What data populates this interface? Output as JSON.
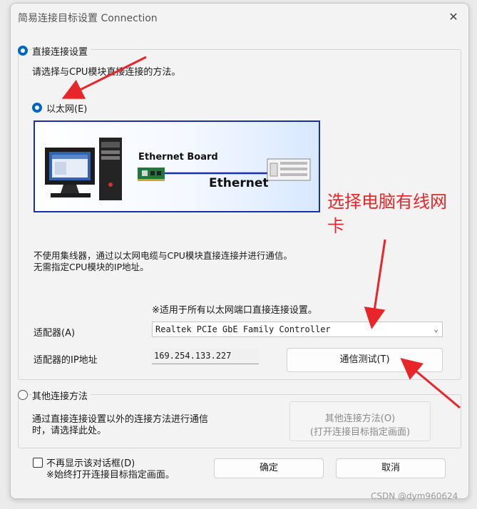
{
  "window": {
    "title": "简易连接目标设置 Connection",
    "close_glyph": "✕"
  },
  "direct_section": {
    "label": "直接连接设置",
    "selected": true,
    "instruction": "请选择与CPU模块直接连接的方法。",
    "ethernet_option": {
      "label": "以太网(E)",
      "selected": true
    },
    "diagram": {
      "board_label": "Ethernet Board",
      "cable_label": "Ethernet"
    },
    "description_line1": "不使用集线器，通过以太网电缆与CPU模块直接连接并进行通信。",
    "description_line2": "无需指定CPU模块的IP地址。",
    "note": "※适用于所有以太网端口直接连接设置。",
    "adapter_label": "适配器(A)",
    "adapter_value": "Realtek PCIe GbE Family Controller",
    "ip_label": "适配器的IP地址",
    "ip_value": "169.254.133.227",
    "test_button": "通信测试(T)"
  },
  "other_section": {
    "label": "其他连接方法",
    "selected": false,
    "description_line1": "通过直接连接设置以外的连接方法进行通信",
    "description_line2": "时，请选择此处。",
    "button_line1": "其他连接方法(O)",
    "button_line2": "(打开连接目标指定画面)"
  },
  "footer": {
    "checkbox_label": "不再显示该对话框(D)",
    "checkbox_note": "※始终打开连接目标指定画面。",
    "checked": false,
    "ok_button": "确定",
    "cancel_button": "取消"
  },
  "annotation": {
    "line1": "选择电脑有线网",
    "line2": "卡",
    "color": "#e8262a"
  },
  "watermark": "CSDN @dym960624",
  "icons": [
    "radio-icon",
    "chevron-down-icon",
    "close-icon",
    "checkbox-icon",
    "pc-icon",
    "network-board-icon",
    "plc-icon",
    "arrow-icon"
  ]
}
